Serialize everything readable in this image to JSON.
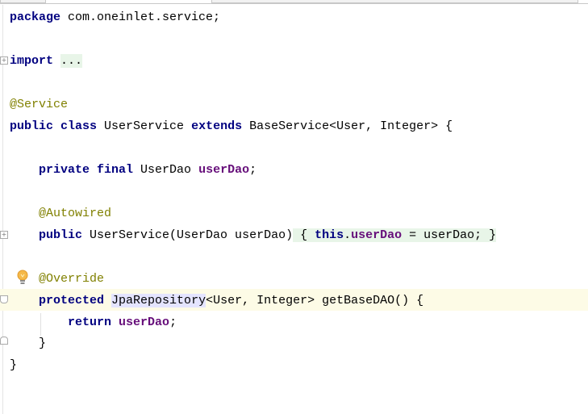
{
  "editor": {
    "lines": [
      {
        "tokens": [
          {
            "t": "package",
            "c": "kw"
          },
          {
            "t": " com.oneinlet.service;",
            "c": ""
          }
        ]
      },
      {
        "tokens": [
          {
            "t": "import",
            "c": "kw"
          },
          {
            "t": " ",
            "c": ""
          },
          {
            "t": "...",
            "c": "fold"
          }
        ]
      },
      {
        "tokens": [
          {
            "t": "@Service",
            "c": "ann"
          }
        ]
      },
      {
        "tokens": [
          {
            "t": "public class",
            "c": "kw"
          },
          {
            "t": " UserService ",
            "c": ""
          },
          {
            "t": "extends",
            "c": "kw"
          },
          {
            "t": " BaseService<User, Integer> {",
            "c": ""
          }
        ]
      },
      {
        "tokens": [
          {
            "t": "    ",
            "c": ""
          },
          {
            "t": "private final",
            "c": "kw"
          },
          {
            "t": " UserDao ",
            "c": ""
          },
          {
            "t": "userDao",
            "c": "fld"
          },
          {
            "t": ";",
            "c": ""
          }
        ]
      },
      {
        "tokens": [
          {
            "t": "    ",
            "c": ""
          },
          {
            "t": "@Autowired",
            "c": "ann"
          }
        ]
      },
      {
        "tokens": [
          {
            "t": "    ",
            "c": ""
          },
          {
            "t": "public",
            "c": "kw"
          },
          {
            "t": " UserService(UserDao userDao)",
            "c": ""
          },
          {
            "t": " { ",
            "c": "fold"
          },
          {
            "t": "this",
            "c": "kw fold"
          },
          {
            "t": ".",
            "c": "fold"
          },
          {
            "t": "userDao",
            "c": "fld fold"
          },
          {
            "t": " = userDao; }",
            "c": "fold"
          }
        ]
      },
      {
        "tokens": [
          {
            "t": "    ",
            "c": ""
          },
          {
            "t": "@Override",
            "c": "ann"
          }
        ]
      },
      {
        "tokens": [
          {
            "t": "    ",
            "c": ""
          },
          {
            "t": "protected",
            "c": "kw"
          },
          {
            "t": " ",
            "c": ""
          },
          {
            "t": "JpaRepository",
            "c": "hl"
          },
          {
            "t": "<User, Integer> getBaseDAO() {",
            "c": ""
          }
        ]
      },
      {
        "tokens": [
          {
            "t": "        ",
            "c": ""
          },
          {
            "t": "return",
            "c": "kw"
          },
          {
            "t": " ",
            "c": ""
          },
          {
            "t": "userDao",
            "c": "fld"
          },
          {
            "t": ";",
            "c": ""
          }
        ]
      },
      {
        "tokens": [
          {
            "t": "    }",
            "c": ""
          }
        ]
      },
      {
        "tokens": [
          {
            "t": "}",
            "c": ""
          }
        ]
      }
    ],
    "colors": {
      "keyword": "#000080",
      "annotation": "#808000",
      "field": "#660e7a",
      "fold_bg": "#e8f5e8",
      "caret_row": "#fdfbe6"
    }
  }
}
